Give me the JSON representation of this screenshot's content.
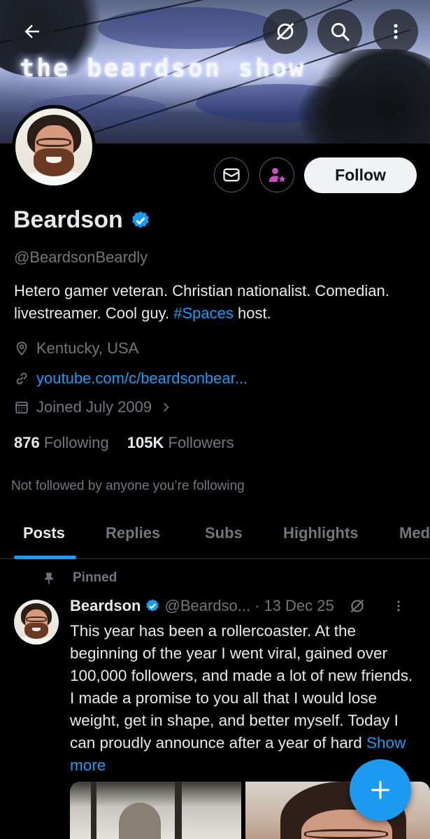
{
  "banner": {
    "title": "the beardson show"
  },
  "profile": {
    "name": "Beardson",
    "handle": "@BeardsonBeardly",
    "bio_text": "Hetero gamer veteran. Christian nationalist. Comedian. livestreamer. Cool guy. ",
    "bio_hashtag": "#Spaces",
    "bio_suffix": " host.",
    "location": "Kentucky, USA",
    "website": "youtube.com/c/beardsonbear...",
    "joined": "Joined July 2009",
    "follow_label": "Follow"
  },
  "stats": {
    "following_count": "876",
    "following_label": "Following",
    "followers_count": "105K",
    "followers_label": "Followers"
  },
  "not_followed_text": "Not followed by anyone you’re following",
  "tabs": [
    {
      "label": "Posts"
    },
    {
      "label": "Replies"
    },
    {
      "label": "Subs"
    },
    {
      "label": "Highlights"
    },
    {
      "label": "Media"
    }
  ],
  "post": {
    "pinned_label": "Pinned",
    "author_name": "Beardson",
    "author_handle": "@Beardso...",
    "date": "13 Dec 25",
    "separator": "·",
    "text": "This year has been a rollercoaster. At the beginning of the year I went viral, gained over 100,000 followers, and made a lot of new friends. I made a promise to you all that I would lose weight, get in shape, and better myself. Today I can proudly announce after a year of hard ",
    "show_more": "Show more"
  },
  "colors": {
    "accent": "#1d9bf0",
    "background": "#000000",
    "muted_text": "#71767b",
    "primary_text": "#e7e9ea",
    "subscribe_icon": "#c850c0"
  },
  "icons": {
    "back": "arrow-left-icon",
    "grok": "grok-icon",
    "search": "search-icon",
    "more": "more-vertical-icon",
    "message": "envelope-icon",
    "subscribe": "subscribe-star-icon",
    "verified": "verified-badge-icon",
    "location": "location-pin-icon",
    "link": "link-icon",
    "calendar": "calendar-icon",
    "pin": "pin-icon",
    "compose": "plus-icon"
  }
}
